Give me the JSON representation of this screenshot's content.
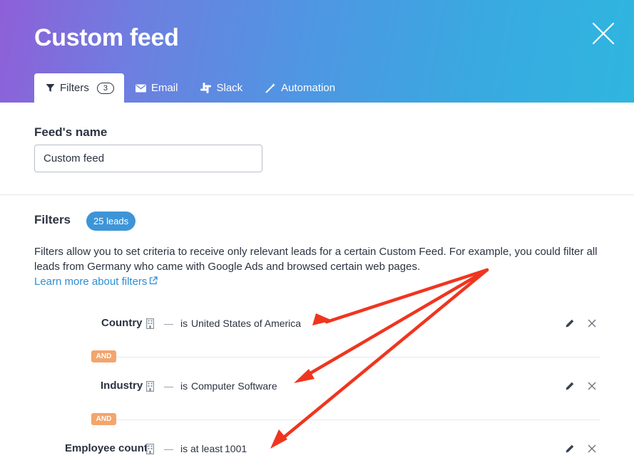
{
  "header": {
    "title": "Custom feed",
    "tabs": [
      {
        "label": "Filters",
        "icon": "filter-icon",
        "count": "3",
        "active": true
      },
      {
        "label": "Email",
        "icon": "envelope-icon"
      },
      {
        "label": "Slack",
        "icon": "slack-icon"
      },
      {
        "label": "Automation",
        "icon": "magic-wand-icon"
      }
    ]
  },
  "feed_name": {
    "label": "Feed's name",
    "value": "Custom feed"
  },
  "filters": {
    "heading": "Filters",
    "leads_badge": "25 leads",
    "description": "Filters allow you to set criteria to receive only relevant leads for a certain Custom Feed. For example, you could filter all leads from Germany who came with Google Ads and browsed certain web pages.",
    "learn_more": "Learn more about filters",
    "connector": "AND",
    "items": [
      {
        "name": "Country",
        "operator": "is",
        "value": "United States of America"
      },
      {
        "name": "Industry",
        "operator": "is",
        "value": "Computer Software"
      },
      {
        "name": "Employee count",
        "operator": "is at least",
        "value": "1001"
      }
    ]
  },
  "colors": {
    "header_gradient_start": "#8f5fd8",
    "header_gradient_end": "#2fb6df",
    "leads_badge": "#3d95d8",
    "and_badge": "#f3a56c",
    "link": "#2b8ed6",
    "annotation_arrow": "#f0351f"
  }
}
